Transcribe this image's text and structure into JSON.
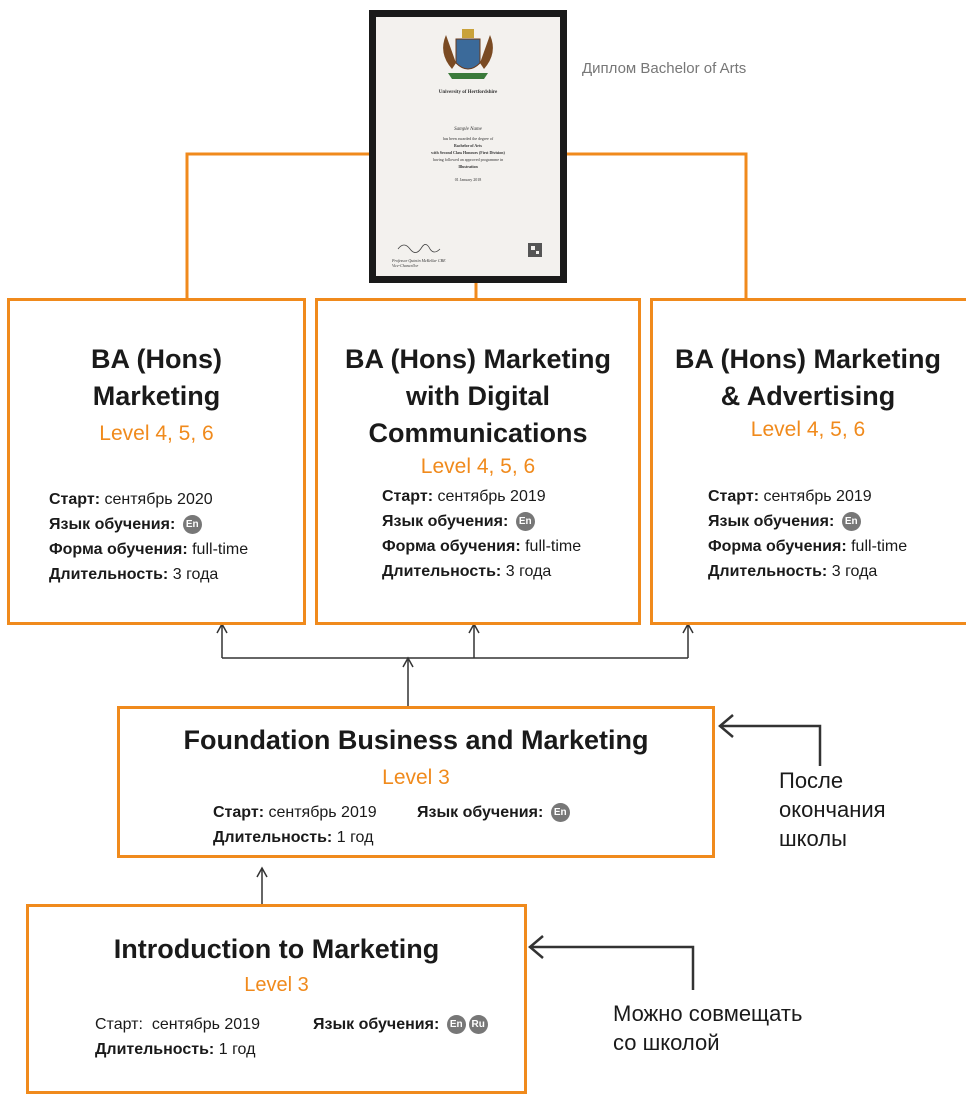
{
  "diploma": {
    "caption": "Диплом Bachelor of Arts",
    "university": "University of Hertfordshire",
    "name": "Sample Name",
    "line1": "has been awarded the degree of",
    "degree": "Bachelor of Arts",
    "honours": "with Second Class Honours (First Division)",
    "line2": "having followed an approved programme in",
    "programme": "Illustration",
    "date": "01 January 2018",
    "signatory": "Professor Quintin McKellar CBE",
    "signatory_title": "Vice-Chancellor"
  },
  "programs": [
    {
      "title_lines": [
        "BA (Hons)",
        "Marketing"
      ],
      "level": "Level 4, 5, 6",
      "start_label": "Старт:",
      "start_value": "сентябрь 2020",
      "lang_label": "Язык обучения:",
      "lang_badges": [
        "En"
      ],
      "form_label": "Форма обучения:",
      "form_value": "full-time",
      "duration_label": "Длительность:",
      "duration_value": "3 года"
    },
    {
      "title_lines": [
        "BA (Hons) Marketing",
        "with Digital",
        "Communications"
      ],
      "level": "Level 4, 5, 6",
      "start_label": "Старт:",
      "start_value": "сентябрь 2019",
      "lang_label": "Язык обучения:",
      "lang_badges": [
        "En"
      ],
      "form_label": "Форма обучения:",
      "form_value": "full-time",
      "duration_label": "Длительность:",
      "duration_value": "3 года"
    },
    {
      "title_lines": [
        "BA (Hons) Marketing",
        "& Advertising"
      ],
      "level": "Level 4, 5, 6",
      "start_label": "Старт:",
      "start_value": "сентябрь 2019",
      "lang_label": "Язык обучения:",
      "lang_badges": [
        "En"
      ],
      "form_label": "Форма обучения:",
      "form_value": "full-time",
      "duration_label": "Длительность:",
      "duration_value": "3 года"
    }
  ],
  "foundation": {
    "title": "Foundation Business and Marketing",
    "level": "Level 3",
    "start_label": "Старт:",
    "start_value": "сентябрь 2019",
    "lang_label": "Язык обучения:",
    "lang_badges": [
      "En"
    ],
    "duration_label": "Длительность:",
    "duration_value": "1 год"
  },
  "intro": {
    "title": "Introduction to Marketing",
    "level": "Level 3",
    "start_label": "Старт:",
    "start_value": "сентябрь  2019",
    "lang_label": "Язык обучения:",
    "lang_badges": [
      "En",
      "Ru"
    ],
    "duration_label": "Длительность:",
    "duration_value": "1 год"
  },
  "notes": {
    "after_school_lines": [
      "После",
      "окончания",
      "школы"
    ],
    "with_school_lines": [
      "Можно совмещать",
      "со школой"
    ]
  },
  "colors": {
    "accent": "#f08a1c",
    "text": "#1a1a1a",
    "badge": "#777777",
    "arrow": "#333333"
  }
}
